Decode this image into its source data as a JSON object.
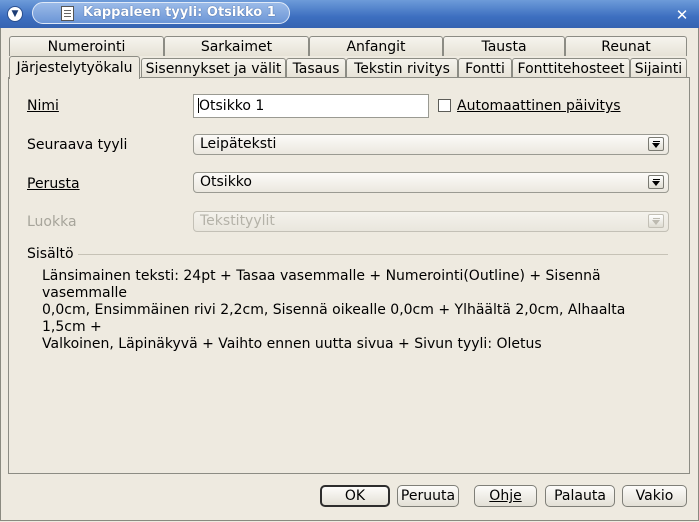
{
  "window": {
    "title": "Kappaleen tyyli: Otsikko 1"
  },
  "tabs": {
    "row1": [
      "Numerointi",
      "Sarkaimet",
      "Anfangit",
      "Tausta",
      "Reunat"
    ],
    "row2": [
      "Järjestelytyökalu",
      "Sisennykset ja välit",
      "Tasaus",
      "Tekstin rivitys",
      "Fontti",
      "Fonttitehosteet",
      "Sijainti"
    ],
    "active": "Järjestelytyökalu"
  },
  "form": {
    "name_label": "Nimi",
    "name_value": "Otsikko 1",
    "auto_update_label": "Automaattinen päivitys",
    "auto_update_checked": false,
    "next_style_label": "Seuraava tyyli",
    "next_style_value": "Leipäteksti",
    "based_on_label": "Perusta",
    "based_on_value": "Otsikko",
    "category_label": "Luokka",
    "category_value": "Tekstityylit"
  },
  "contents": {
    "heading": "Sisältö",
    "line1": "Länsimainen teksti: 24pt + Tasaa vasemmalle + Numerointi(Outline) + Sisennä vasemmalle",
    "line2": "0,0cm, Ensimmäinen rivi 2,2cm, Sisennä oikealle 0,0cm + Ylhäältä 2,0cm, Alhaalta 1,5cm +",
    "line3": "Valkoinen, Läpinäkyvä + Vaihto ennen uutta sivua + Sivun tyyli: Oletus"
  },
  "buttons": {
    "ok": "OK",
    "cancel": "Peruuta",
    "help": "Ohje",
    "reset": "Palauta",
    "standard": "Vakio"
  },
  "icons": {
    "window_menu": "window-menu-icon",
    "document": "document-icon",
    "close": "close-icon",
    "dropdown": "dropdown-arrow-icon"
  }
}
